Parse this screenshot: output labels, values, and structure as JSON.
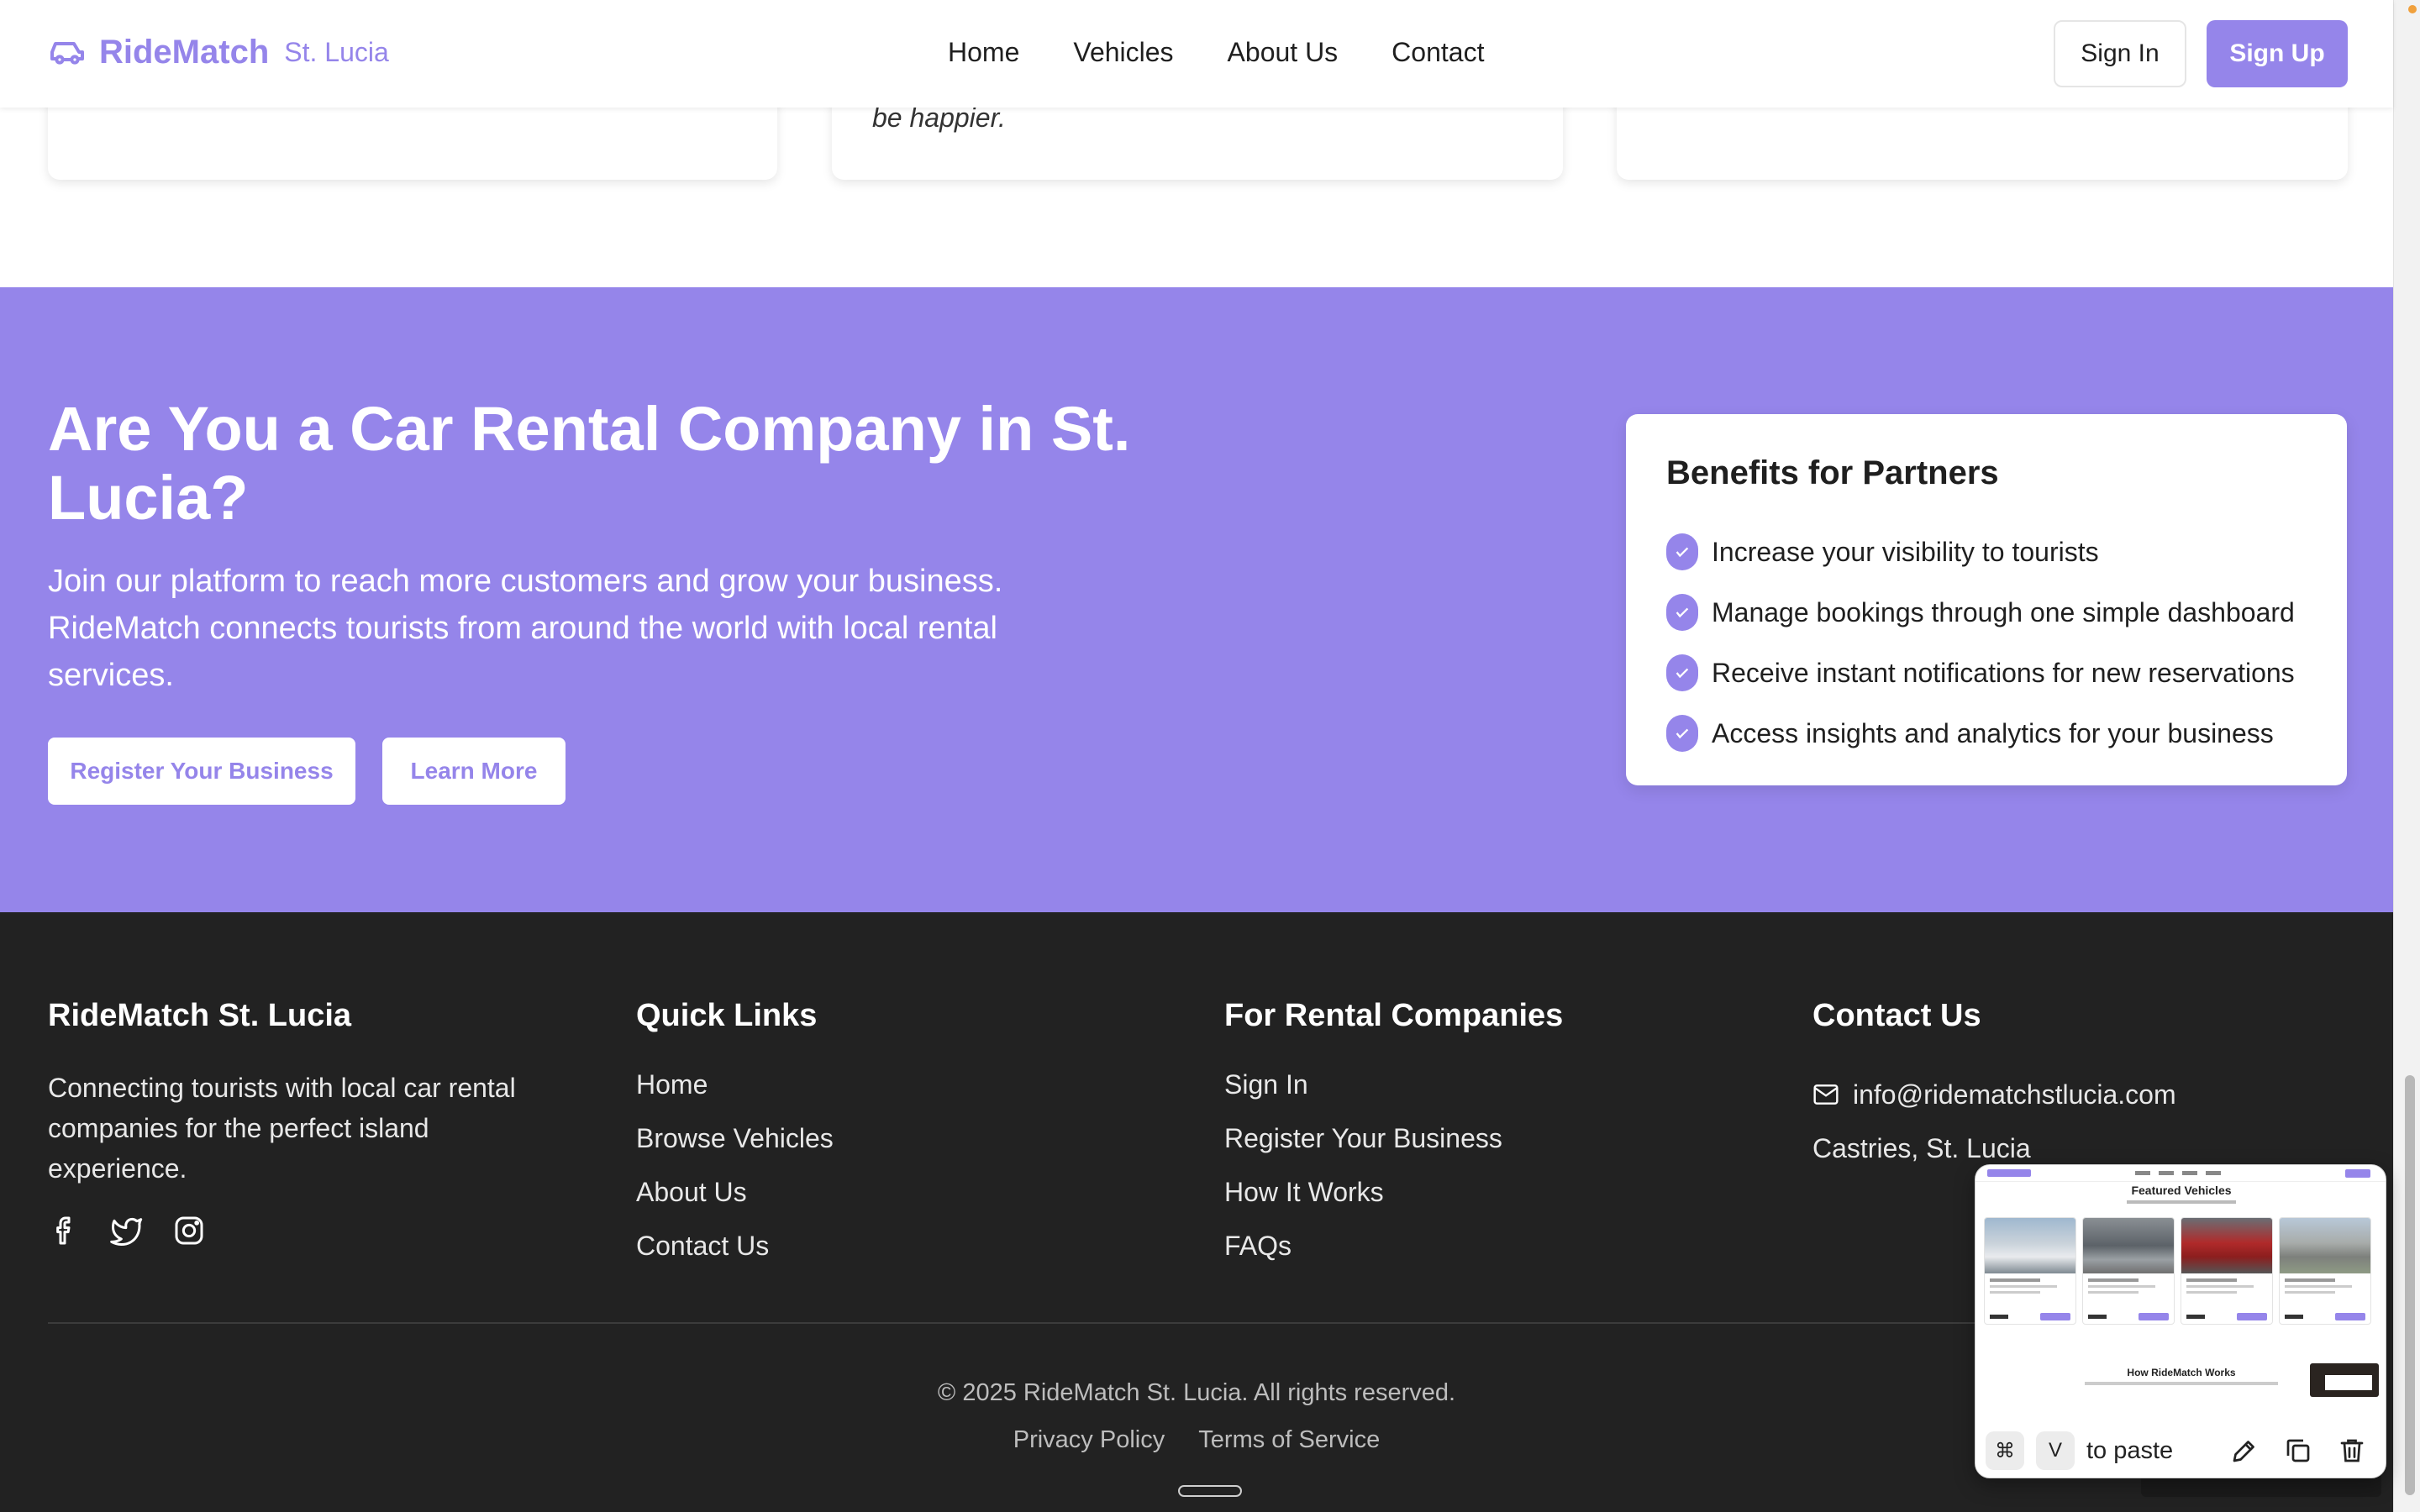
{
  "header": {
    "brand_name": "RideMatch",
    "brand_sub": "St. Lucia",
    "logo_icon": "car-icon",
    "nav": [
      "Home",
      "Vehicles",
      "About Us",
      "Contact"
    ],
    "sign_in": "Sign In",
    "sign_up": "Sign Up"
  },
  "testimonials": {
    "visible_quote_fragment": "be happier."
  },
  "partner_cta": {
    "title": "Are You a Car Rental Company in St. Lucia?",
    "text": "Join our platform to reach more customers and grow your business. RideMatch connects tourists from around the world with local rental services.",
    "register_button": "Register Your Business",
    "learn_button": "Learn More",
    "benefits_title": "Benefits for Partners",
    "benefits": [
      "Increase your visibility to tourists",
      "Manage bookings through one simple dashboard",
      "Receive instant notifications for new reservations",
      "Access insights and analytics for your business"
    ],
    "check_icon": "check-icon"
  },
  "footer": {
    "brand_title": "RideMatch St. Lucia",
    "brand_desc": "Connecting tourists with local car rental companies for the perfect island experience.",
    "social_icons": [
      "facebook-icon",
      "twitter-icon",
      "instagram-icon"
    ],
    "quick_links_title": "Quick Links",
    "quick_links": [
      "Home",
      "Browse Vehicles",
      "About Us",
      "Contact Us"
    ],
    "rental_title": "For Rental Companies",
    "rental_links": [
      "Sign In",
      "Register Your Business",
      "How It Works",
      "FAQs"
    ],
    "contact_title": "Contact Us",
    "contact_email": "info@ridematchstlucia.com",
    "contact_location": "Castries, St. Lucia",
    "copyright": "© 2025 RideMatch St. Lucia. All rights reserved.",
    "privacy": "Privacy Policy",
    "terms": "Terms of Service"
  },
  "screenshot_thumbnail": {
    "title": "Featured Vehicles",
    "section2": "How RideMatch Works",
    "key_cmd": "⌘",
    "key_v": "V",
    "paste_hint": "to paste"
  },
  "colors": {
    "accent": "#9585ea",
    "footer_bg": "#222222"
  }
}
